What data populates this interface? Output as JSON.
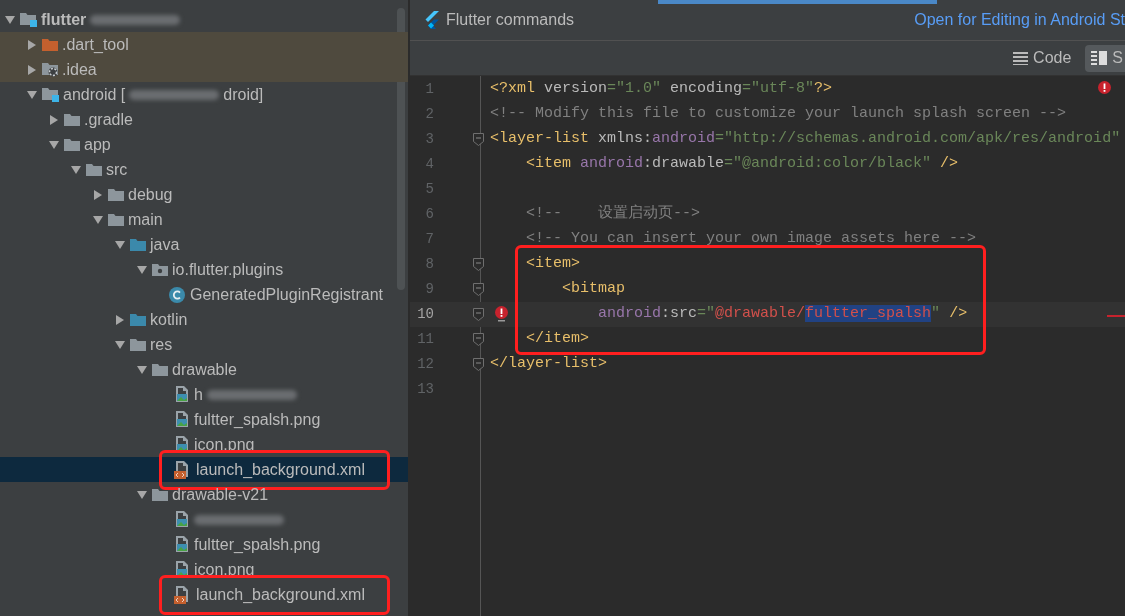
{
  "project_tree": {
    "items": [
      {
        "label": "flutter",
        "bold": true,
        "blurred": true,
        "kind": "module",
        "expanded": true,
        "selected": false,
        "children": [
          {
            "label": ".dart_tool",
            "kind": "excluded",
            "expanded": false,
            "ignored": true,
            "selected": false
          },
          {
            "label": ".idea",
            "kind": "idea",
            "expanded": false,
            "ignored": true,
            "selected": false
          },
          {
            "label": "android [",
            "label_end": "droid]",
            "blurred": true,
            "kind": "module",
            "expanded": true,
            "selected": false,
            "children": [
              {
                "label": ".gradle",
                "kind": "folder",
                "expanded": false,
                "selected": false
              },
              {
                "label": "app",
                "kind": "folder",
                "expanded": true,
                "selected": false,
                "children": [
                  {
                    "label": "src",
                    "kind": "folder",
                    "expanded": true,
                    "selected": false,
                    "children": [
                      {
                        "label": "debug",
                        "kind": "folder",
                        "expanded": false,
                        "selected": false
                      },
                      {
                        "label": "main",
                        "kind": "folder",
                        "expanded": true,
                        "selected": false,
                        "children": [
                          {
                            "label": "java",
                            "kind": "source",
                            "expanded": true,
                            "selected": false,
                            "children": [
                              {
                                "label": "io.flutter.plugins",
                                "kind": "package",
                                "expanded": true,
                                "selected": false,
                                "children": [
                                  {
                                    "label": "GeneratedPluginRegistrant",
                                    "kind": "class",
                                    "selected": false
                                  }
                                ]
                              }
                            ]
                          },
                          {
                            "label": "kotlin",
                            "kind": "source",
                            "expanded": false,
                            "selected": false
                          },
                          {
                            "label": "res",
                            "kind": "folder",
                            "expanded": true,
                            "selected": false,
                            "children": [
                              {
                                "label": "drawable",
                                "kind": "folder",
                                "expanded": true,
                                "selected": false,
                                "children": [
                                  {
                                    "label": "h",
                                    "blurred": true,
                                    "kind": "image",
                                    "selected": false
                                  },
                                  {
                                    "label": "fultter_spalsh.png",
                                    "kind": "image",
                                    "selected": false
                                  },
                                  {
                                    "label": "icon.png",
                                    "kind": "image",
                                    "selected": false
                                  },
                                  {
                                    "label": "launch_background.xml",
                                    "kind": "xml",
                                    "selected": true,
                                    "outlined": true
                                  }
                                ]
                              },
                              {
                                "label": "drawable-v21",
                                "kind": "folder",
                                "expanded": true,
                                "selected": false,
                                "children": [
                                  {
                                    "blurred": true,
                                    "kind": "image",
                                    "selected": false
                                  },
                                  {
                                    "label": "fultter_spalsh.png",
                                    "kind": "image",
                                    "selected": false
                                  },
                                  {
                                    "label": "icon.png",
                                    "kind": "image",
                                    "selected": false
                                  },
                                  {
                                    "label": "launch_background.xml",
                                    "kind": "xml",
                                    "selected": false,
                                    "outlined": true
                                  }
                                ]
                              }
                            ]
                          }
                        ]
                      }
                    ]
                  }
                ]
              }
            ]
          }
        ]
      }
    ]
  },
  "editor": {
    "banner": {
      "title": "Flutter commands",
      "link": "Open for Editing in Android St"
    },
    "view_buttons": [
      {
        "label": "Code",
        "kind": "code",
        "selected": false
      },
      {
        "label": "S",
        "kind": "split",
        "selected": true
      }
    ],
    "lines": [
      {
        "number": "1",
        "tokens": [
          {
            "t": "<?xml ",
            "kind": "tag"
          },
          {
            "t": "version",
            "kind": "attr"
          },
          {
            "t": "=\"1.0\"",
            "kind": "str"
          },
          {
            "t": " encoding",
            "kind": "attr"
          },
          {
            "t": "=\"utf-8\"",
            "kind": "str"
          },
          {
            "t": "?>",
            "kind": "tag"
          }
        ]
      },
      {
        "number": "2",
        "tokens": [
          {
            "t": "<!-- Modify this file to customize your launch splash screen -->",
            "kind": "comment"
          }
        ]
      },
      {
        "number": "3",
        "fold": true,
        "tokens": [
          {
            "t": "<layer-list ",
            "kind": "tag"
          },
          {
            "t": "xmlns:",
            "kind": "attr"
          },
          {
            "t": "android",
            "kind": "ns"
          },
          {
            "t": "=\"http://schemas.android.com/apk/res/android\"",
            "kind": "str"
          }
        ]
      },
      {
        "number": "4",
        "tokens": [
          {
            "t": "    <item ",
            "kind": "tag"
          },
          {
            "t": "android",
            "kind": "ns"
          },
          {
            "t": ":drawable",
            "kind": "attr"
          },
          {
            "t": "=\"@android:color/black\"",
            "kind": "str"
          },
          {
            "t": " />",
            "kind": "tag"
          }
        ]
      },
      {
        "number": "5"
      },
      {
        "number": "6",
        "tokens": [
          {
            "t": "    <!--    设置启动页-->",
            "kind": "comment"
          }
        ]
      },
      {
        "number": "7",
        "tokens": [
          {
            "t": "    <!-- You can insert your own image assets here -->",
            "kind": "comment"
          }
        ]
      },
      {
        "number": "8",
        "fold": true,
        "outlined": true,
        "tokens": [
          {
            "t": "    <item>",
            "kind": "tag"
          }
        ]
      },
      {
        "number": "9",
        "fold": true,
        "outlined": true,
        "tokens": [
          {
            "t": "        <bitmap",
            "kind": "tag"
          }
        ]
      },
      {
        "number": "10",
        "fold": true,
        "outlined": true,
        "current": true,
        "error": true,
        "tokens": [
          {
            "t": "            android",
            "kind": "ns"
          },
          {
            "t": ":src",
            "kind": "attr"
          },
          {
            "t": "=\"",
            "kind": "str"
          },
          {
            "t": "@drawable/",
            "kind": "err"
          },
          {
            "t": "fultter_spalsh",
            "kind": "errsel"
          },
          {
            "t": "\"",
            "kind": "str"
          },
          {
            "t": " />",
            "kind": "tag"
          }
        ]
      },
      {
        "number": "11",
        "fold": true,
        "outlined": true,
        "tokens": [
          {
            "t": "    </item>",
            "kind": "tag"
          }
        ]
      },
      {
        "number": "12",
        "fold": true,
        "tokens": [
          {
            "t": "</layer-list>",
            "kind": "tag"
          }
        ]
      },
      {
        "number": "13"
      }
    ]
  }
}
